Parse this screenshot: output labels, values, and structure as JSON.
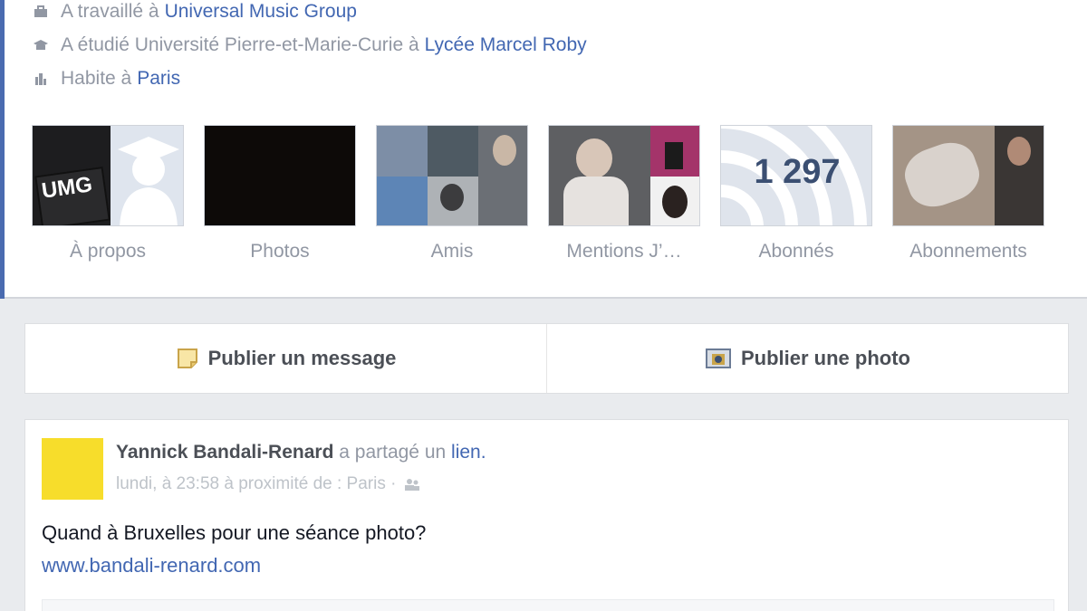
{
  "profile_info": {
    "work": {
      "prefix": "A travaillé à",
      "link": "Universal Music Group",
      "icon": "briefcase-icon"
    },
    "education": {
      "prefix": "A étudié Université Pierre-et-Marie-Curie à",
      "link": "Lycée Marcel Roby",
      "icon": "graduation-cap-icon"
    },
    "location": {
      "prefix": "Habite à",
      "link": "Paris",
      "icon": "home-icon"
    }
  },
  "tiles": [
    {
      "label": "À propos",
      "thumb_text": "UMG"
    },
    {
      "label": "Photos"
    },
    {
      "label": "Amis"
    },
    {
      "label": "Mentions J’…"
    },
    {
      "label": "Abonnés",
      "count": "1 297"
    },
    {
      "label": "Abonnements"
    }
  ],
  "composer": {
    "message_label": "Publier un message",
    "photo_label": "Publier une photo"
  },
  "post": {
    "author": "Yannick Bandali-Renard",
    "action": "a partagé un",
    "link_word": "lien.",
    "meta": "lundi, à 23:58 à proximité de : Paris ·",
    "text": "Quand à Bruxelles pour une séance photo?",
    "url": "www.bandali-renard.com"
  },
  "colors": {
    "link": "#4267b2",
    "muted": "#9197a3",
    "avatar": "#f7dd2b"
  }
}
